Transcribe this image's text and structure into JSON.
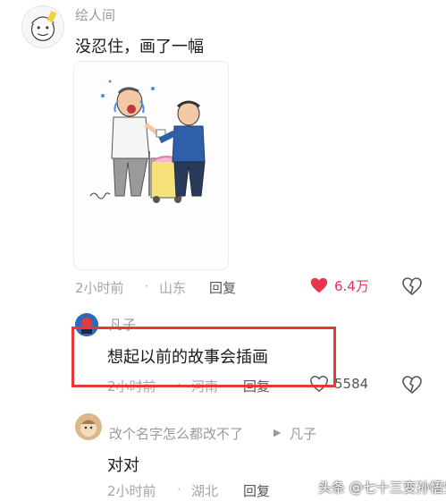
{
  "comments": [
    {
      "username": "绘人间",
      "text": "没忍住，画了一幅",
      "time": "2小时前",
      "location": "山东",
      "reply_label": "回复",
      "likes": "6.4万",
      "liked": true
    },
    {
      "username": "凡子",
      "text": "想起以前的故事会插画",
      "time": "2小时前",
      "location": "河南",
      "reply_label": "回复",
      "likes": "5584",
      "liked": false
    },
    {
      "username": "改个名字怎么都改不了",
      "reply_to": "凡子",
      "text": "对对",
      "time": "2小时前",
      "location": "湖北",
      "reply_label": "回复",
      "likes": "",
      "liked": false
    }
  ],
  "separator": "·",
  "reply_arrow": "▶",
  "watermark": "头条 @七十三变孙悟空",
  "colors": {
    "like_active": "#e8344e",
    "highlight_border": "#e53935",
    "meta_text": "#a5a5a5"
  }
}
